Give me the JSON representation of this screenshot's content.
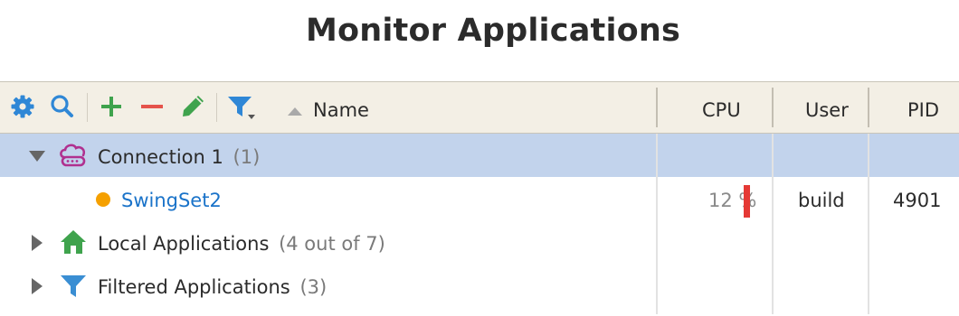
{
  "title": "Monitor Applications",
  "toolbar": {
    "icons": [
      "gear-icon",
      "search-icon",
      "plus-icon",
      "minus-icon",
      "pencil-icon",
      "filter-icon"
    ]
  },
  "columns": {
    "name": "Name",
    "cpu": "CPU",
    "user": "User",
    "pid": "PID",
    "sort_direction": "ascending"
  },
  "tree": {
    "connection": {
      "label": "Connection 1",
      "count": "(1)",
      "expanded": true,
      "selected": true
    },
    "app": {
      "name": "SwingSet2",
      "cpu": "12 %",
      "cpu_fraction": 1.0,
      "user": "build",
      "pid": "4901",
      "status_color": "#f5a000"
    },
    "local": {
      "label": "Local Applications",
      "count": "(4 out of 7)",
      "expanded": false
    },
    "filtered": {
      "label": "Filtered Applications",
      "count": "(3)",
      "expanded": false
    }
  },
  "colors": {
    "header_bg": "#f3efe5",
    "selection": "#c2d3ec",
    "link": "#1a73c9",
    "cpu_bar": "#e53935",
    "add": "#3fa34d",
    "remove": "#e5534b",
    "gear": "#2f87d6"
  }
}
